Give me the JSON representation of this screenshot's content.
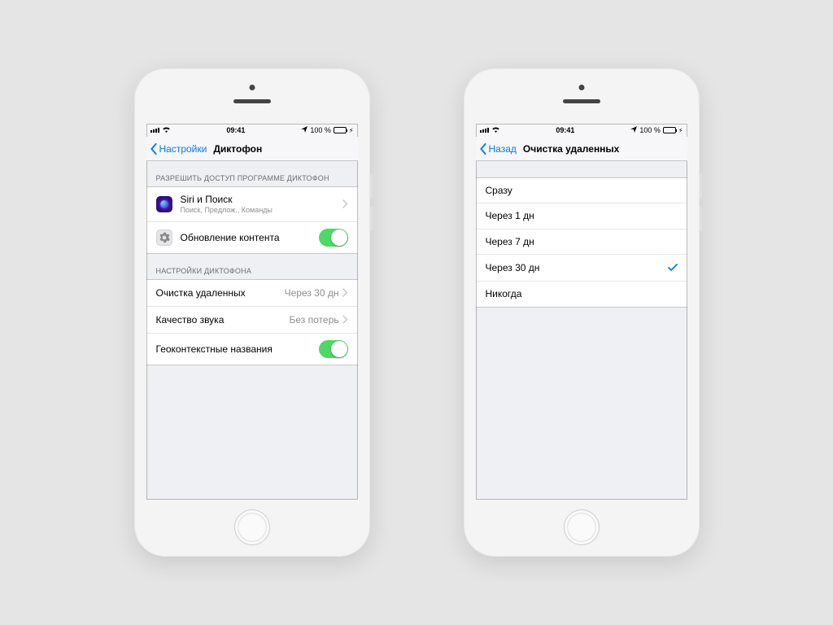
{
  "status": {
    "time": "09:41",
    "battery": "100 %",
    "nav_icon": "⇧"
  },
  "left": {
    "back_label": "Настройки",
    "title": "Диктофон",
    "section1_header": "РАЗРЕШИТЬ ДОСТУП ПРОГРАММЕ ДИКТОФОН",
    "siri_title": "Siri и Поиск",
    "siri_sub": "Поиск, Предлож., Команды",
    "refresh_title": "Обновление контента",
    "section2_header": "НАСТРОЙКИ ДИКТОФОНА",
    "clear_label": "Очистка удаленных",
    "clear_value": "Через 30 дн",
    "quality_label": "Качество звука",
    "quality_value": "Без потерь",
    "geo_label": "Геоконтекстные названия"
  },
  "right": {
    "back_label": "Назад",
    "title": "Очистка удаленных",
    "options": [
      {
        "label": "Сразу",
        "selected": false
      },
      {
        "label": "Через 1 дн",
        "selected": false
      },
      {
        "label": "Через 7 дн",
        "selected": false
      },
      {
        "label": "Через 30 дн",
        "selected": true
      },
      {
        "label": "Никогда",
        "selected": false
      }
    ]
  }
}
